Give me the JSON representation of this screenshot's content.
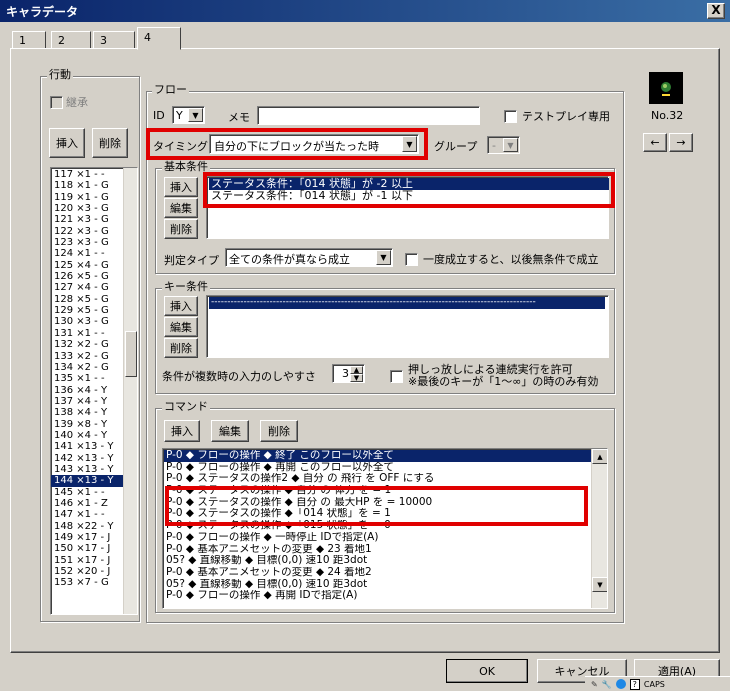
{
  "window": {
    "title": "キャラデータ",
    "close_glyph": "X"
  },
  "tabs": [
    "1",
    "2",
    "3",
    "4"
  ],
  "action_group": {
    "label": "行動",
    "inherit_label": "継承",
    "insert": "挿入",
    "delete": "削除",
    "list": [
      "117 ×1 - -",
      "118 ×1 - G",
      "119 ×1 - G",
      "120 ×3 - G",
      "121 ×3 - G",
      "122 ×3 - G",
      "123 ×3 - G",
      "124 ×1 - -",
      "125 ×4 - G",
      "126 ×5 - G",
      "127 ×4 - G",
      "128 ×5 - G",
      "129 ×5 - G",
      "130 ×3 - G",
      "131 ×1 - -",
      "132 ×2 - G",
      "133 ×2 - G",
      "134 ×2 - G",
      "135 ×1 - -",
      "136 ×4 - Y",
      "137 ×4 - Y",
      "138 ×4 - Y",
      "139 ×8 - Y",
      "140 ×4 - Y",
      "141 ×13 - Y",
      "142 ×13 - Y",
      "143 ×13 - Y",
      "144 ×13 - Y",
      "145 ×1 - -",
      "146 ×1 - Z",
      "147 ×1 - -",
      "148 ×22 - Y",
      "149 ×17 - J",
      "150 ×17 - J",
      "151 ×17 - J",
      "152 ×20 - J",
      "153 ×7 - G"
    ],
    "selected_index": 27
  },
  "flow": {
    "label": "フロー",
    "id_label": "ID",
    "id_value": "Y",
    "memo_label": "メモ",
    "memo_value": "",
    "testplay_label": "テストプレイ専用",
    "timing_label": "タイミング",
    "timing_value": "自分の下にブロックが当たった時",
    "group_label": "グループ",
    "group_value": "-"
  },
  "basic_conditions": {
    "label": "基本条件",
    "insert": "挿入",
    "edit": "編集",
    "delete": "削除",
    "items": [
      "ステータス条件：「014 状態」が -2 以上",
      "ステータス条件：「014 状態」が -1 以下"
    ],
    "judge_label": "判定タイプ",
    "judge_value": "全ての条件が真なら成立",
    "once_label": "一度成立すると、以後無条件で成立"
  },
  "key_conditions": {
    "label": "キー条件",
    "insert": "挿入",
    "edit": "編集",
    "delete": "削除",
    "items": [
      "----------------------------------------------------------------------------------------------------"
    ],
    "multi_label": "条件が複数時の入力のしやすさ",
    "multi_value": "3",
    "hold_label": "押しっ放しによる連続実行を許可",
    "hold_note": "※最後のキーが「1〜∞」の時のみ有効"
  },
  "commands": {
    "label": "コマンド",
    "insert": "挿入",
    "edit": "編集",
    "delete": "削除",
    "items": [
      "P-0 ◆ フローの操作 ◆ 終了 このフロー以外全て",
      "P-0 ◆ フローの操作 ◆ 再開 このフロー以外全て",
      "P-0 ◆ ステータスの操作2 ◆ 自分 の 飛行 を OFF にする",
      "P-0 ◆ ステータスの操作 ◆ 自分 の 体力 を = 1",
      "P-0 ◆ ステータスの操作 ◆ 自分 の 最大HP を = 10000",
      "P-0 ◆ ステータスの操作 ◆「014 状態」を = 1",
      "P-0 ◆ ステータスの操作 ◆「015 状態」を = 0",
      "P-0 ◆ フローの操作 ◆ 一時停止 IDで指定(A)",
      "P-0 ◆ 基本アニメセットの変更 ◆ 23 着地1",
      "05? ◆ 直線移動 ◆ 目標(0,0) 速10 距3dot",
      "P-0 ◆ 基本アニメセットの変更 ◆ 24 着地2",
      "05? ◆ 直線移動 ◆ 目標(0,0) 速10 距3dot",
      "P-0 ◆ フローの操作 ◆ 再開 IDで指定(A)"
    ],
    "selected_index": 0
  },
  "character": {
    "number": "No.32",
    "prev": "←",
    "next": "→"
  },
  "footer": {
    "ok": "OK",
    "cancel": "キャンセル",
    "apply": "適用(A)"
  },
  "taskbar": {
    "caps": "CAPS"
  }
}
